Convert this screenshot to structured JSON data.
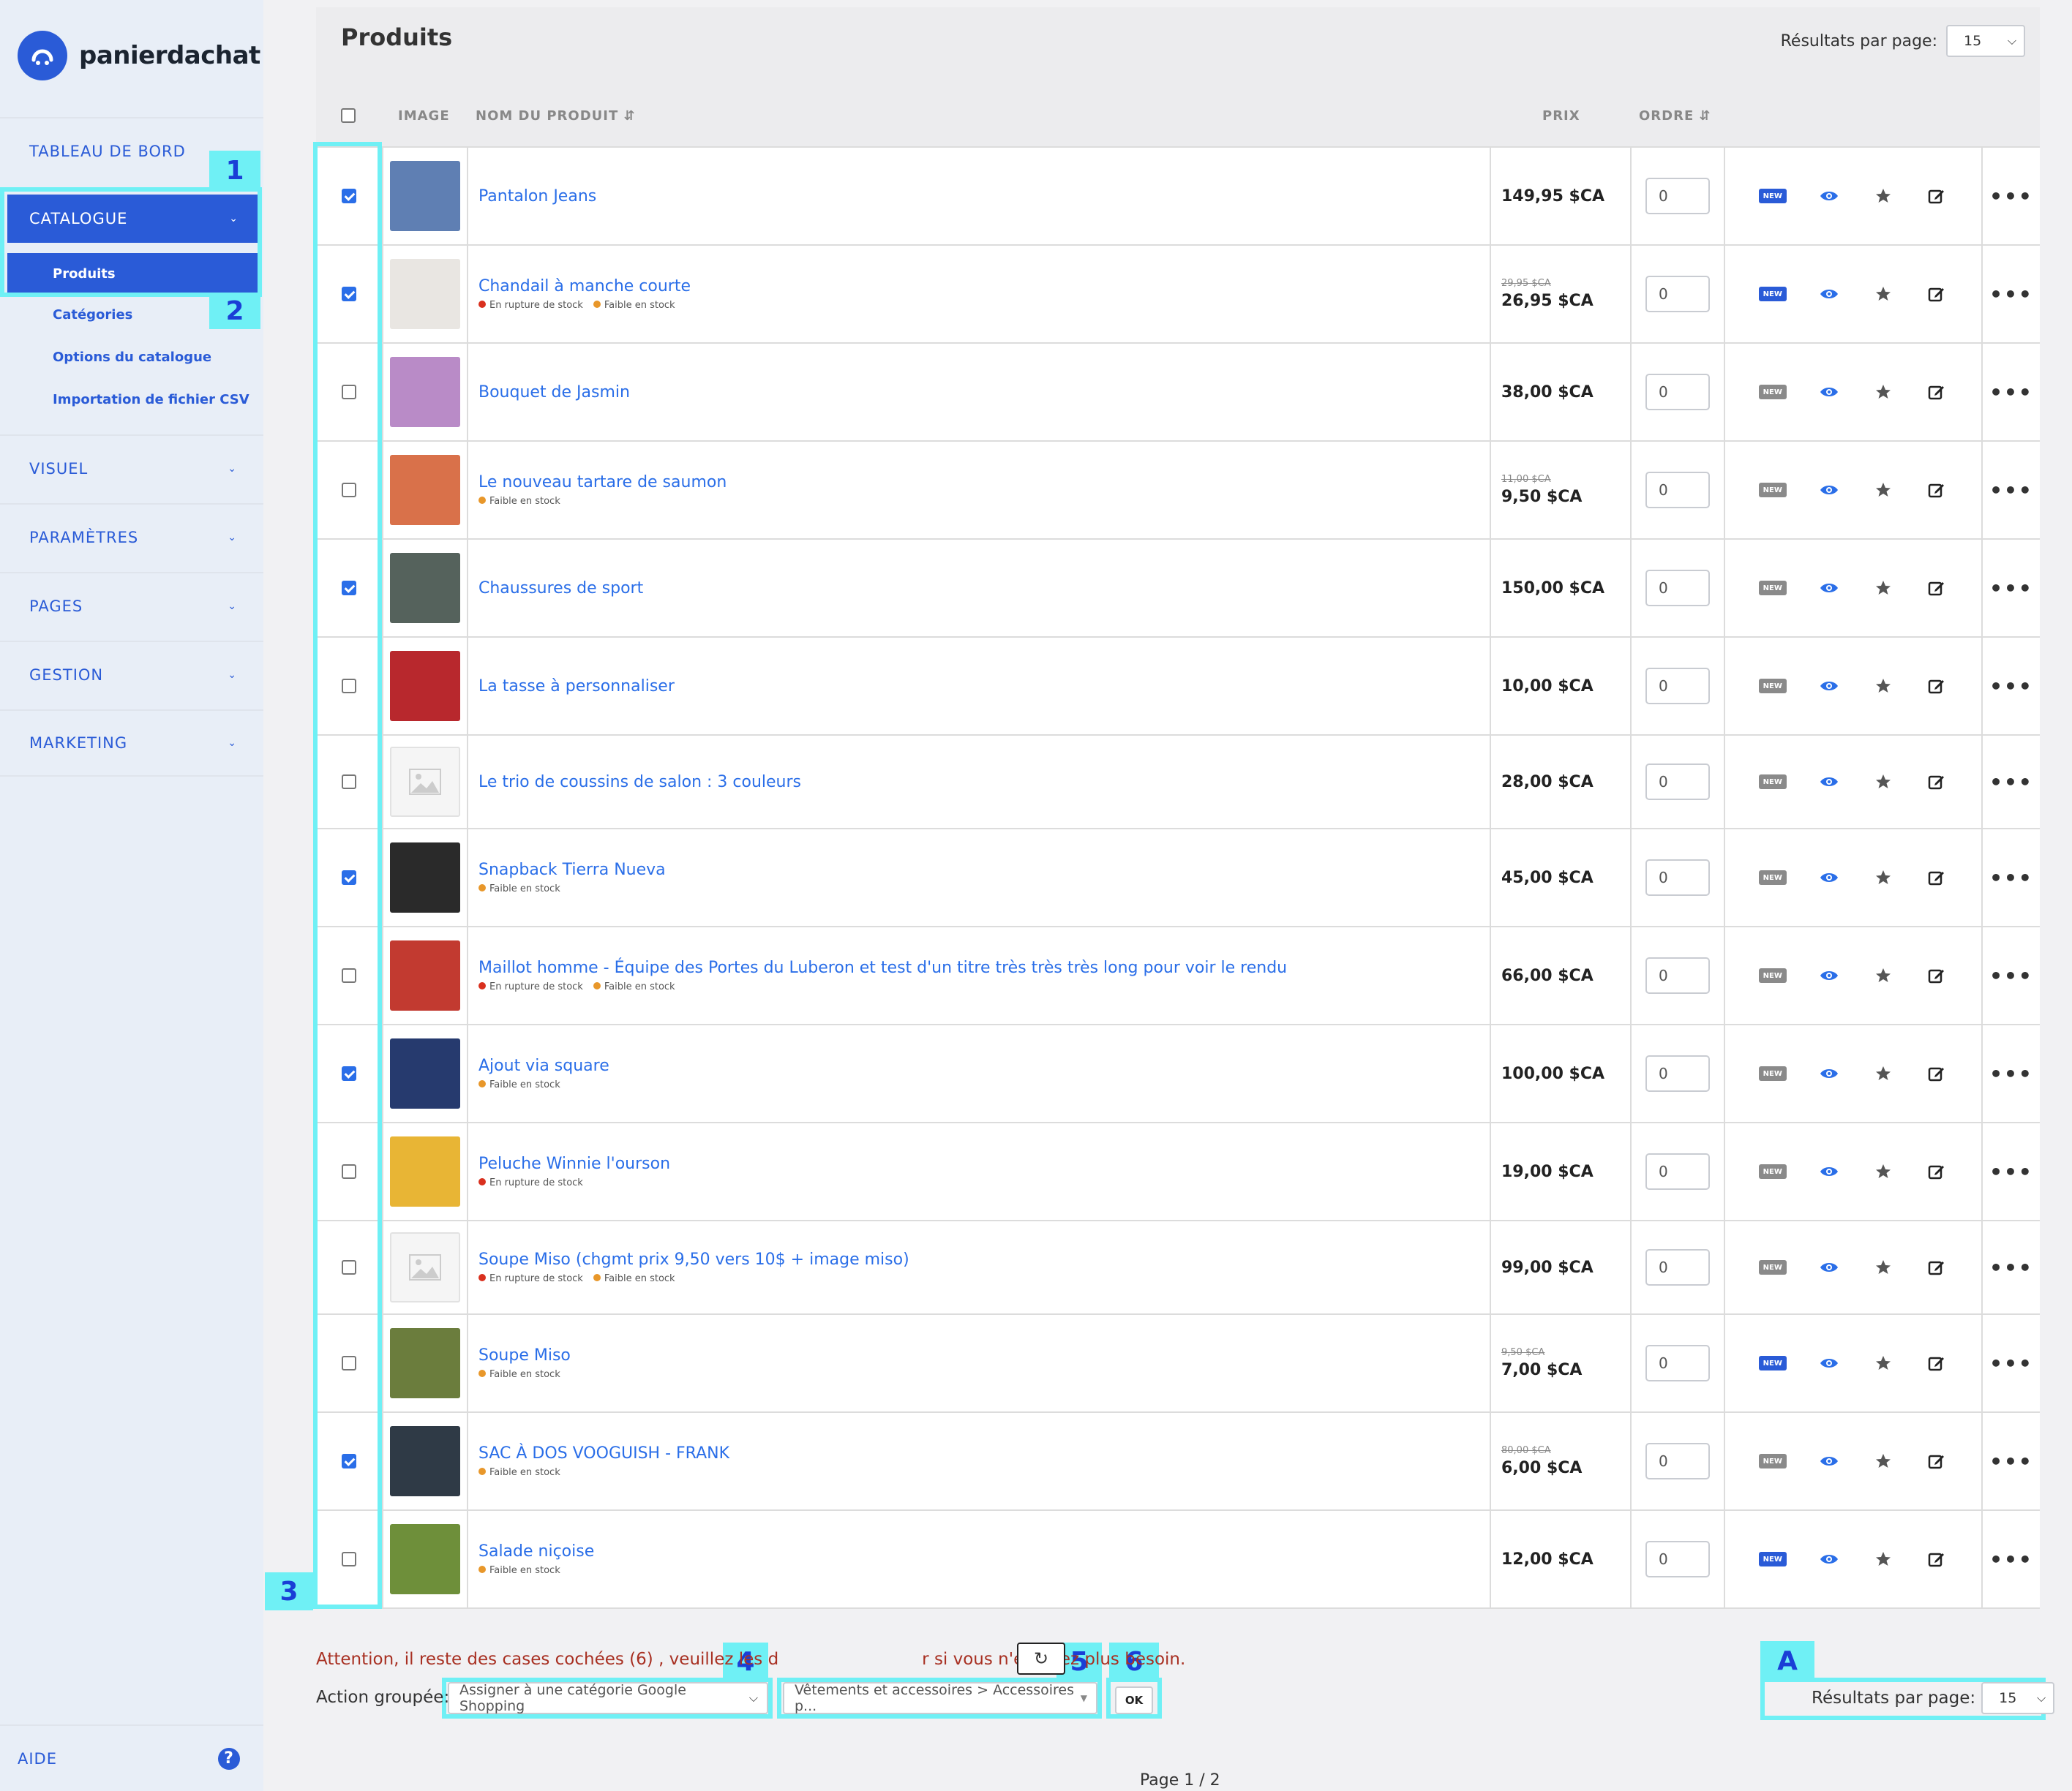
{
  "brand": {
    "name": "panierdachat"
  },
  "sidebar": {
    "items": [
      {
        "label": "TABLEAU DE BORD"
      },
      {
        "label": "CATALOGUE"
      },
      {
        "label": "VISUEL"
      },
      {
        "label": "PARAMÈTRES"
      },
      {
        "label": "PAGES"
      },
      {
        "label": "GESTION"
      },
      {
        "label": "MARKETING"
      }
    ],
    "catalogue_sub": [
      {
        "label": "Produits"
      },
      {
        "label": "Catégories"
      },
      {
        "label": "Options du catalogue"
      },
      {
        "label": "Importation de fichier CSV"
      }
    ],
    "help_label": "AIDE",
    "help_icon": "?"
  },
  "main": {
    "title": "Produits",
    "results_per_page_label": "Résultats par page:",
    "results_per_page_value": "15",
    "columns": {
      "image": "IMAGE",
      "name": "NOM DU PRODUIT",
      "price": "PRIX",
      "order": "ORDRE"
    },
    "products": [
      {
        "name": "Pantalon Jeans",
        "price": "149,95 $CA",
        "old_price": "",
        "order": "0",
        "checked": true,
        "badge_new": true,
        "stock": [],
        "thumb_color": "#5f7fb3"
      },
      {
        "name": "Chandail à manche courte",
        "price": "26,95 $CA",
        "old_price": "29,95 $CA",
        "order": "0",
        "checked": true,
        "badge_new": true,
        "stock": [
          "En rupture de stock",
          "Faible en stock"
        ],
        "thumb_color": "#e9e6e2"
      },
      {
        "name": "Bouquet de Jasmin",
        "price": "38,00 $CA",
        "old_price": "",
        "order": "0",
        "checked": false,
        "badge_new": false,
        "stock": [],
        "thumb_color": "#b98bc7"
      },
      {
        "name": "Le nouveau tartare de saumon",
        "price": "9,50 $CA",
        "old_price": "11,00 $CA",
        "order": "0",
        "checked": false,
        "badge_new": false,
        "stock": [
          "Faible en stock"
        ],
        "thumb_color": "#d9714a"
      },
      {
        "name": "Chaussures de sport",
        "price": "150,00 $CA",
        "old_price": "",
        "order": "0",
        "checked": true,
        "badge_new": false,
        "stock": [],
        "thumb_color": "#55625c"
      },
      {
        "name": "La tasse à personnaliser",
        "price": "10,00 $CA",
        "old_price": "",
        "order": "0",
        "checked": false,
        "badge_new": false,
        "stock": [],
        "thumb_color": "#b8282d"
      },
      {
        "name": "Le trio de coussins de salon : 3 couleurs",
        "price": "28,00 $CA",
        "old_price": "",
        "order": "0",
        "checked": false,
        "badge_new": false,
        "stock": [],
        "thumb_color": ""
      },
      {
        "name": "Snapback Tierra Nueva",
        "price": "45,00 $CA",
        "old_price": "",
        "order": "0",
        "checked": true,
        "badge_new": false,
        "stock": [
          "Faible en stock"
        ],
        "thumb_color": "#2a2a2a"
      },
      {
        "name": "Maillot homme - Équipe des Portes du Luberon et test d'un titre très très très long pour voir le rendu",
        "price": "66,00 $CA",
        "old_price": "",
        "order": "0",
        "checked": false,
        "badge_new": false,
        "stock": [
          "En rupture de stock",
          "Faible en stock"
        ],
        "thumb_color": "#c23a30"
      },
      {
        "name": "Ajout via square",
        "price": "100,00 $CA",
        "old_price": "",
        "order": "0",
        "checked": true,
        "badge_new": false,
        "stock": [
          "Faible en stock"
        ],
        "thumb_color": "#263a6e"
      },
      {
        "name": "Peluche Winnie l'ourson",
        "price": "19,00 $CA",
        "old_price": "",
        "order": "0",
        "checked": false,
        "badge_new": false,
        "stock": [
          "En rupture de stock"
        ],
        "thumb_color": "#e8b535"
      },
      {
        "name": "Soupe Miso (chgmt prix 9,50 vers 10$ + image miso)",
        "price": "99,00 $CA",
        "old_price": "",
        "order": "0",
        "checked": false,
        "badge_new": false,
        "stock": [
          "En rupture de stock",
          "Faible en stock"
        ],
        "thumb_color": ""
      },
      {
        "name": "Soupe Miso",
        "price": "7,00 $CA",
        "old_price": "9,50 $CA",
        "order": "0",
        "checked": false,
        "badge_new": true,
        "stock": [
          "Faible en stock"
        ],
        "thumb_color": "#6b7d3d"
      },
      {
        "name": "SAC À DOS VOOGUISH - FRANK",
        "price": "6,00 $CA",
        "old_price": "80,00 $CA",
        "order": "0",
        "checked": true,
        "badge_new": false,
        "stock": [
          "Faible en stock"
        ],
        "thumb_color": "#2f3a46"
      },
      {
        "name": "Salade niçoise",
        "price": "12,00 $CA",
        "old_price": "",
        "order": "0",
        "checked": false,
        "badge_new": true,
        "stock": [
          "Faible en stock"
        ],
        "thumb_color": "#6e8f3a"
      }
    ]
  },
  "bottom": {
    "warning_before": "Attention, il reste des cases cochées (6) , veuillez les d",
    "warning_after": "r si vous n'en avez plus besoin.",
    "action_label": "Action groupée:",
    "action_select": "Assigner à une catégorie Google Shopping",
    "category_select": "Vêtements et accessoires > Accessoires p...",
    "ok_label": "OK",
    "results_per_page_label": "Résultats par page:",
    "results_per_page_value": "15",
    "pagination": "Page 1 / 2"
  },
  "annotations": [
    "1",
    "2",
    "3",
    "4",
    "5",
    "6",
    "A"
  ],
  "colors": {
    "accent": "#2a5bd7",
    "link": "#2a6ee8",
    "highlight": "#6ff0f5",
    "warning": "#a83022"
  }
}
